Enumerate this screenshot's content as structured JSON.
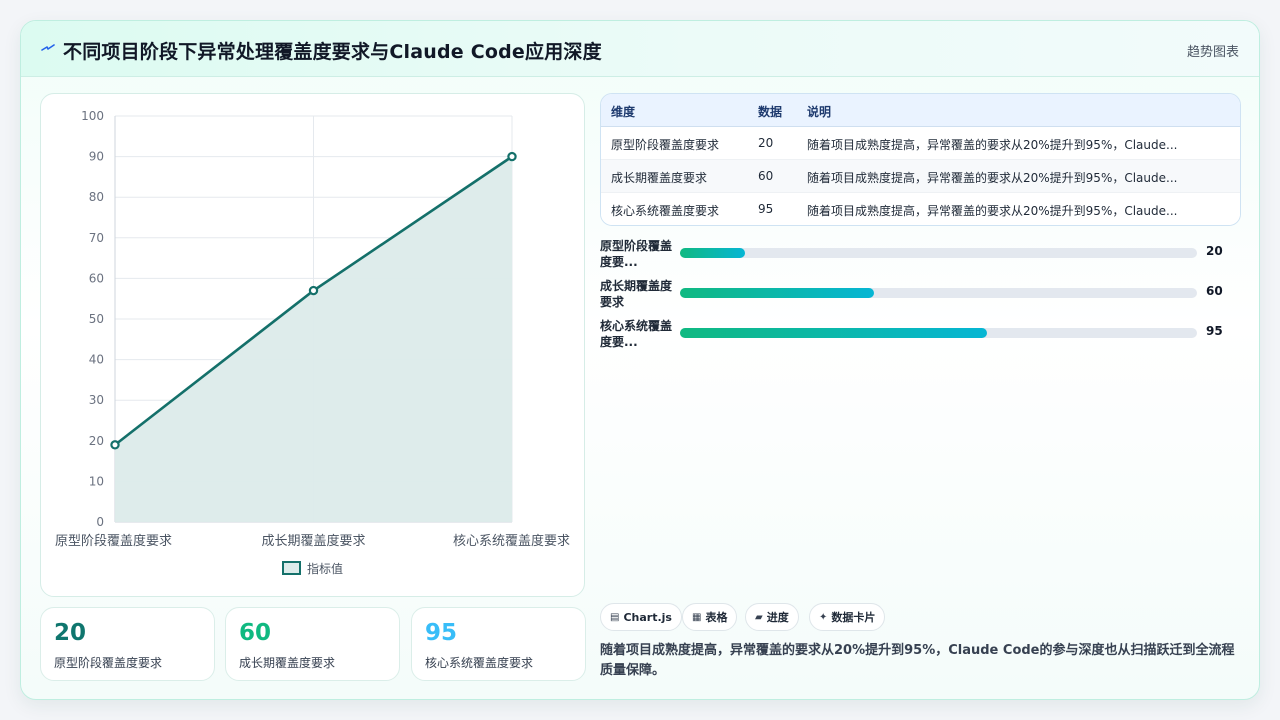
{
  "header": {
    "title": "不同项目阶段下异常处理覆盖度要求与Claude Code应用深度",
    "kind_label": "趋势图表"
  },
  "chart_data": {
    "type": "area",
    "categories": [
      "原型阶段覆盖度要求",
      "成长期覆盖度要求",
      "核心系统覆盖度要求"
    ],
    "series": [
      {
        "name": "指标值",
        "values": [
          19,
          57,
          90
        ]
      }
    ],
    "ylim": [
      0,
      100
    ],
    "yticks": [
      0,
      10,
      20,
      30,
      40,
      50,
      60,
      70,
      80,
      90,
      100
    ],
    "grid": true,
    "legend": "bottom",
    "colors": {
      "line": "#14706a",
      "fill": "#dcebea"
    }
  },
  "stats": [
    {
      "value": "20",
      "label": "原型阶段覆盖度要求",
      "color": "#0f766e"
    },
    {
      "value": "60",
      "label": "成长期覆盖度要求",
      "color": "#10b981"
    },
    {
      "value": "95",
      "label": "核心系统覆盖度要求",
      "color": "#38bdf8"
    }
  ],
  "table": {
    "headers": [
      "维度",
      "数据",
      "说明"
    ],
    "rows": [
      [
        "原型阶段覆盖度要求",
        "20",
        "随着项目成熟度提高，异常覆盖的要求从20%提升到95%，Claude..."
      ],
      [
        "成长期覆盖度要求",
        "60",
        "随着项目成熟度提高，异常覆盖的要求从20%提升到95%，Claude..."
      ],
      [
        "核心系统覆盖度要求",
        "95",
        "随着项目成熟度提高，异常覆盖的要求从20%提升到95%，Claude..."
      ]
    ]
  },
  "progress": [
    {
      "label": "原型阶段覆盖度要...",
      "value": "20",
      "fraction": 0.125
    },
    {
      "label": "成长期覆盖度要求",
      "value": "60",
      "fraction": 0.375
    },
    {
      "label": "核心系统覆盖度要...",
      "value": "95",
      "fraction": 0.593
    }
  ],
  "pills": [
    {
      "icon": "▤",
      "label": "Chart.js"
    },
    {
      "icon": "▦",
      "label": "表格"
    },
    {
      "icon": "▰",
      "label": "进度"
    },
    {
      "icon": "✦",
      "label": "数据卡片"
    }
  ],
  "summary": "随着项目成熟度提高，异常覆盖的要求从20%提升到95%，Claude Code的参与深度也从扫描跃迁到全流程质量保障。"
}
